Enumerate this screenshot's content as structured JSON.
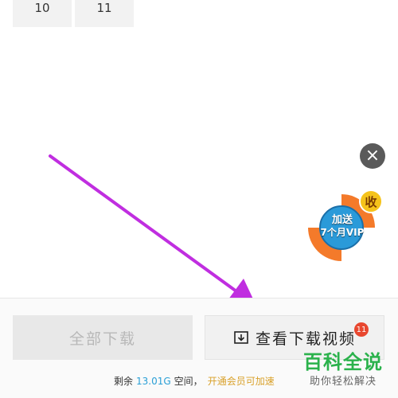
{
  "grid": {
    "tiles": [
      "10",
      "11"
    ]
  },
  "promo": {
    "line1": "加送",
    "line2": "7个月VIP",
    "badge": "收"
  },
  "actions": {
    "download_all": "全部下载",
    "view_downloads": "查看下载视频",
    "download_count": "11"
  },
  "storage": {
    "prefix": "剩余",
    "size": "13.01G",
    "suffix": "空间，",
    "vip_link": "开通会员可加速"
  },
  "watermark": {
    "title": "百科全说",
    "subtitle": "助你轻松解决"
  },
  "colors": {
    "arrow": "#c02ee0",
    "accent_blue": "#2a9fd6",
    "vip_gold": "#d9a12b",
    "badge_red": "#e8472f",
    "brand_green": "#2bb24c"
  },
  "icons": {
    "close": "close-icon",
    "download": "download-box-icon"
  }
}
